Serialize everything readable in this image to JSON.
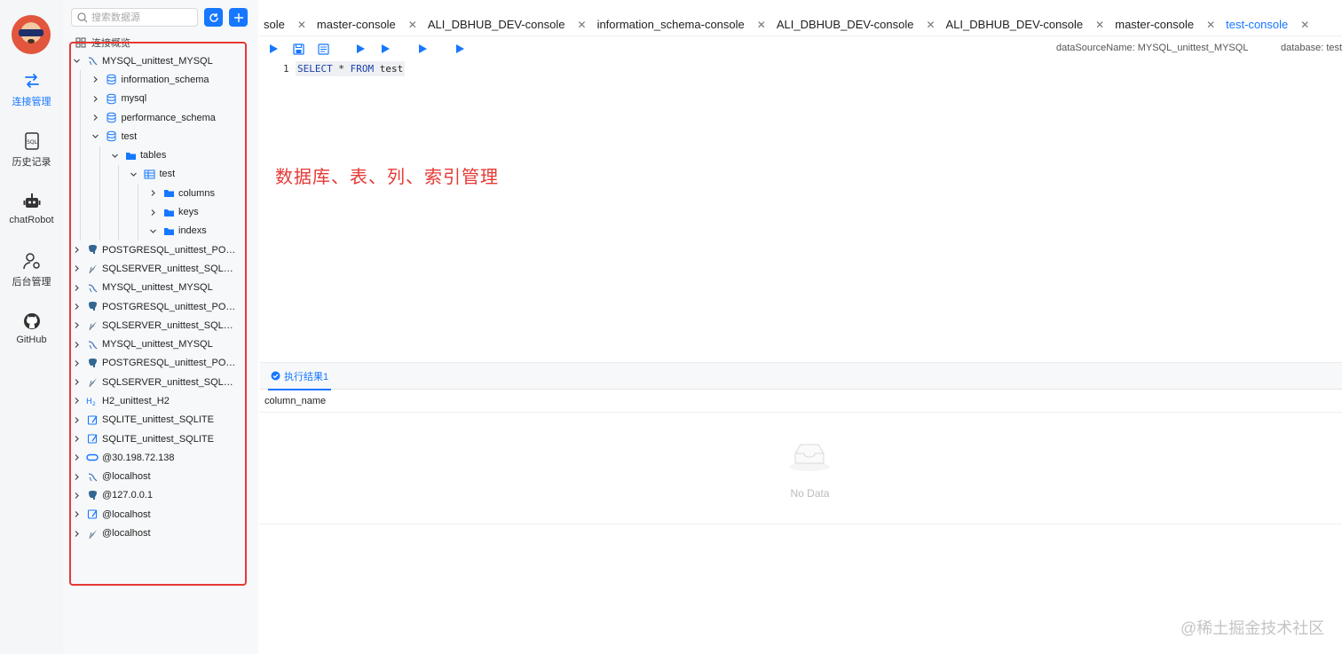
{
  "rail": {
    "items": [
      {
        "label": "连接管理",
        "icon": "connection-icon",
        "active": true
      },
      {
        "label": "历史记录",
        "icon": "sql-history-icon"
      },
      {
        "label": "chatRobot",
        "icon": "robot-icon"
      },
      {
        "label": "后台管理",
        "icon": "user-settings-icon"
      },
      {
        "label": "GitHub",
        "icon": "github-icon"
      }
    ]
  },
  "sidebar": {
    "search_placeholder": "搜索数据源",
    "overview_label": "连接概览",
    "tree": [
      {
        "label": "MYSQL_unittest_MYSQL",
        "type": "mysql",
        "expanded": true
      },
      {
        "label": "information_schema",
        "type": "database"
      },
      {
        "label": "mysql",
        "type": "database"
      },
      {
        "label": "performance_schema",
        "type": "database"
      },
      {
        "label": "test",
        "type": "database",
        "expanded": true
      },
      {
        "label": "tables",
        "type": "folder",
        "expanded": true
      },
      {
        "label": "test",
        "type": "table",
        "expanded": true
      },
      {
        "label": "columns",
        "type": "folder"
      },
      {
        "label": "keys",
        "type": "folder"
      },
      {
        "label": "indexs",
        "type": "folder",
        "expanded": true
      },
      {
        "label": "POSTGRESQL_unittest_POSTGRESQL",
        "type": "postgresql"
      },
      {
        "label": "SQLSERVER_unittest_SQLSERVER",
        "type": "sqlserver"
      },
      {
        "label": "MYSQL_unittest_MYSQL",
        "type": "mysql"
      },
      {
        "label": "POSTGRESQL_unittest_POSTGRESQL",
        "type": "postgresql"
      },
      {
        "label": "SQLSERVER_unittest_SQLSERVER",
        "type": "sqlserver"
      },
      {
        "label": "MYSQL_unittest_MYSQL",
        "type": "mysql"
      },
      {
        "label": "POSTGRESQL_unittest_POSTGRESQL",
        "type": "postgresql"
      },
      {
        "label": "SQLSERVER_unittest_SQLSERVER",
        "type": "sqlserver"
      },
      {
        "label": "H2_unittest_H2",
        "type": "h2"
      },
      {
        "label": "SQLITE_unittest_SQLITE",
        "type": "sqlite"
      },
      {
        "label": "SQLITE_unittest_SQLITE",
        "type": "sqlite"
      },
      {
        "label": "@30.198.72.138",
        "type": "oracle"
      },
      {
        "label": "@localhost",
        "type": "mysql"
      },
      {
        "label": "@127.0.0.1",
        "type": "postgresql"
      },
      {
        "label": "@localhost",
        "type": "sqlite"
      },
      {
        "label": "@localhost",
        "type": "sqlserver"
      }
    ]
  },
  "tabs": [
    {
      "label": "sole"
    },
    {
      "label": "master-console"
    },
    {
      "label": "ALI_DBHUB_DEV-console"
    },
    {
      "label": "information_schema-console"
    },
    {
      "label": "ALI_DBHUB_DEV-console"
    },
    {
      "label": "ALI_DBHUB_DEV-console"
    },
    {
      "label": "master-console"
    },
    {
      "label": "test-console",
      "active": true
    }
  ],
  "editor": {
    "datasource_label": "dataSourceName: MYSQL_unittest_MYSQL",
    "database_label": "database: test",
    "line_number": "1",
    "code_keyword1": "SELECT",
    "code_star": "*",
    "code_keyword2": "FROM",
    "code_table": "test"
  },
  "annotation": "数据库、表、列、索引管理",
  "results": {
    "tab_label": "执行结果1",
    "column_header": "column_name",
    "empty_text": "No Data"
  },
  "watermark": "@稀土掘金技术社区",
  "colors": {
    "accent": "#1677ff",
    "highlight": "#e53935"
  }
}
